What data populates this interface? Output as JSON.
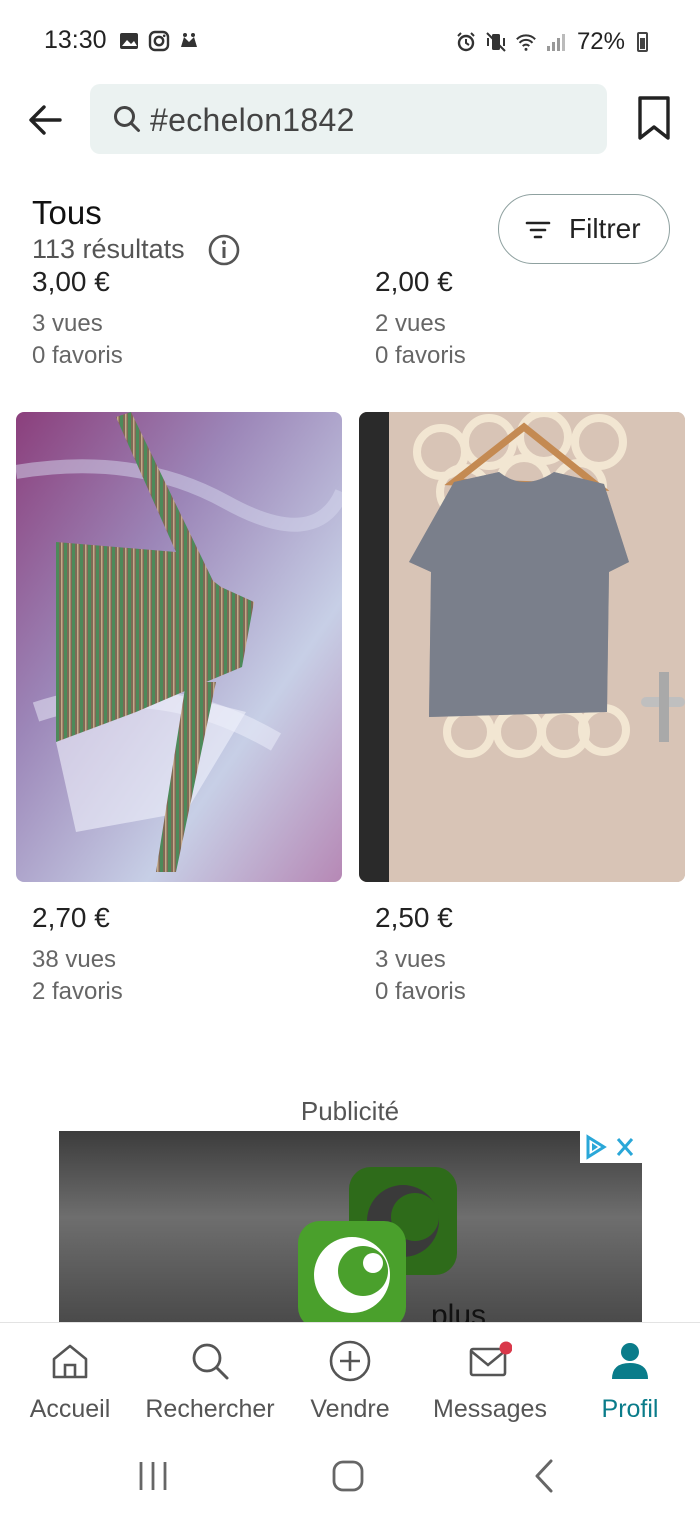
{
  "status_bar": {
    "time": "13:30",
    "battery": "72%",
    "icons_left": [
      "gallery-icon",
      "instagram-icon",
      "app-icon"
    ],
    "icons_right": [
      "alarm-icon",
      "vibrate-icon",
      "wifi-icon",
      "signal-icon",
      "battery-icon"
    ]
  },
  "header": {
    "search_value": "#echelon1842"
  },
  "results": {
    "title": "Tous",
    "count": "113 résultats",
    "filter_label": "Filtrer"
  },
  "items_top_clipped": [
    {
      "price": "3,00 €",
      "views": "3 vues",
      "favorites": "0 favoris"
    },
    {
      "price": "2,00 €",
      "views": "2 vues",
      "favorites": "0 favoris"
    }
  ],
  "items": [
    {
      "price": "2,70 €",
      "views": "38 vues",
      "favorites": "2 favoris"
    },
    {
      "price": "2,50 €",
      "views": "3 vues",
      "favorites": "0 favoris"
    }
  ],
  "ad": {
    "label": "Publicité",
    "partial_text": "plus"
  },
  "bottom_nav": [
    {
      "label": "Accueil",
      "icon": "home-icon",
      "active": false
    },
    {
      "label": "Rechercher",
      "icon": "search-icon",
      "active": false
    },
    {
      "label": "Vendre",
      "icon": "plus-circle-icon",
      "active": false
    },
    {
      "label": "Messages",
      "icon": "mail-icon",
      "active": false
    },
    {
      "label": "Profil",
      "icon": "profile-icon",
      "active": true
    }
  ],
  "colors": {
    "accent": "#0a7c8a",
    "search_bg": "#ebf2f1",
    "notification_dot": "#d9384a"
  }
}
